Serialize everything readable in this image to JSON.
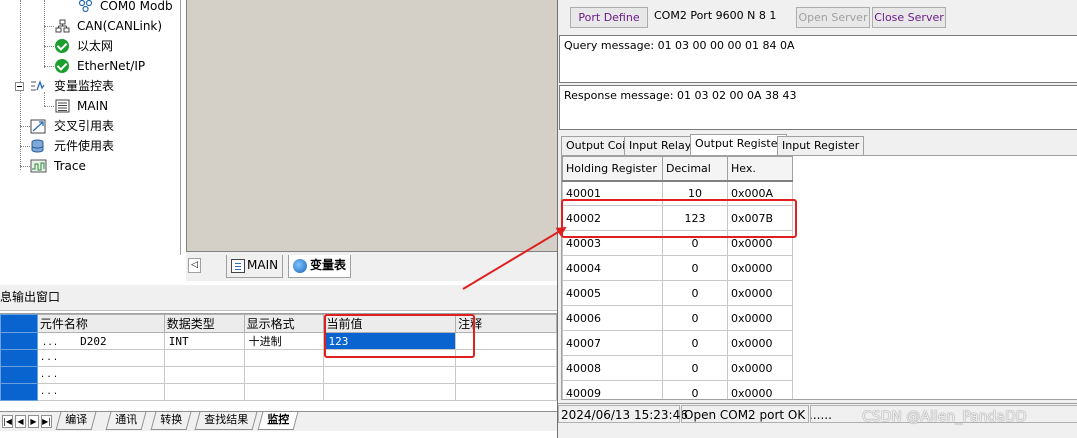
{
  "tree": {
    "items": [
      {
        "label": "COM0 Modb",
        "icon": "modbus-node-icon"
      },
      {
        "label": "CAN(CANLink)",
        "icon": "can-network-icon"
      },
      {
        "label": "以太网",
        "icon": "green-check-icon"
      },
      {
        "label": "EtherNet/IP",
        "icon": "green-check-icon"
      },
      {
        "label": "变量监控表",
        "icon": "variable-monitor-icon"
      },
      {
        "label": "MAIN",
        "icon": "table-icon"
      },
      {
        "label": "交叉引用表",
        "icon": "cross-reference-icon"
      },
      {
        "label": "元件使用表",
        "icon": "database-icon"
      },
      {
        "label": "Trace",
        "icon": "trace-icon"
      }
    ]
  },
  "editor_tabs": [
    {
      "label": "MAIN",
      "icon": "ladder-icon",
      "active": false
    },
    {
      "label": "变量表",
      "icon": "globe-icon",
      "active": true
    }
  ],
  "output": {
    "title": "息输出窗口",
    "columns": [
      "元件名称",
      "数据类型",
      "显示格式",
      "当前值",
      "注释"
    ],
    "rows": [
      {
        "dots": "...",
        "name": "D202",
        "type": "INT",
        "format": "十进制",
        "value": "123",
        "comment": ""
      },
      {
        "dots": "...",
        "name": "",
        "type": "",
        "format": "",
        "value": "",
        "comment": ""
      },
      {
        "dots": "...",
        "name": "",
        "type": "",
        "format": "",
        "value": "",
        "comment": ""
      },
      {
        "dots": "...",
        "name": "",
        "type": "",
        "format": "",
        "value": "",
        "comment": ""
      }
    ],
    "tabs": [
      "编译",
      "通讯",
      "转换",
      "查找结果",
      "监控"
    ],
    "active_tab": "监控"
  },
  "modbus": {
    "port_define": "Port Define",
    "port_info": "COM2 Port 9600 N 8 1",
    "open_server": "Open Server",
    "close_server": "Close Server",
    "query": "Query message: 01 03 00 00 00 01 84 0A",
    "response": "Response message: 01 03 02 00 0A 38 43",
    "tabs": [
      "Output Coil",
      "Input Relay",
      "Output Register",
      "Input Register"
    ],
    "active_tab": "Output Register",
    "table": {
      "headers": [
        "Holding Register",
        "Decimal",
        "Hex."
      ],
      "rows": [
        [
          "40001",
          "10",
          "0x000A"
        ],
        [
          "40002",
          "123",
          "0x007B"
        ],
        [
          "40003",
          "0",
          "0x0000"
        ],
        [
          "40004",
          "0",
          "0x0000"
        ],
        [
          "40005",
          "0",
          "0x0000"
        ],
        [
          "40006",
          "0",
          "0x0000"
        ],
        [
          "40007",
          "0",
          "0x0000"
        ],
        [
          "40008",
          "0",
          "0x0000"
        ],
        [
          "40009",
          "0",
          "0x0000"
        ]
      ]
    },
    "status": {
      "timestamp": "2024/06/13 15:23:46",
      "message": "Open COM2 port OK ......"
    }
  },
  "watermark": "CSDN @Allen_PandaDD",
  "colors": {
    "highlight": "#0a64d0",
    "annotation_red": "#e02020",
    "workspace_gray": "#d4d0c8",
    "button_purple": "#6a1b8a"
  }
}
